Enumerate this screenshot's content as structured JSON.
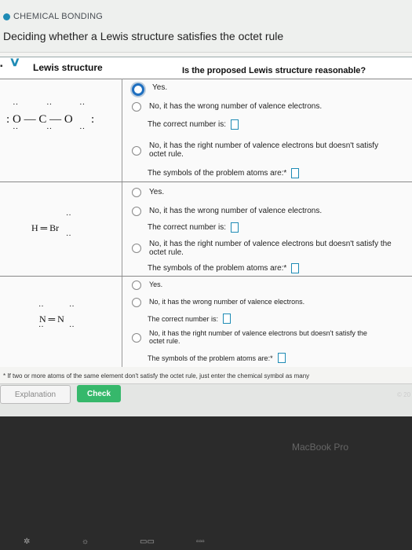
{
  "header": {
    "topic": "CHEMICAL BONDING",
    "title": "Deciding whether a Lewis structure satisfies the octet rule"
  },
  "table": {
    "col1": "Lewis structure",
    "col2": "Is the proposed Lewis structure reasonable?",
    "rows": [
      {
        "structure": "O — C — O",
        "opt_yes": "Yes.",
        "opt_wrong": "No, it has the wrong number of valence electrons.",
        "correct_number": "The correct number is:",
        "opt_octet_line1": "No, it has the right number of valence electrons but doesn't satisfy",
        "opt_octet_line2": "octet rule.",
        "symbols": "The symbols of the problem atoms are:*"
      },
      {
        "structure": "H ═ Br",
        "opt_yes": "Yes.",
        "opt_wrong": "No, it has the wrong number of valence electrons.",
        "correct_number": "The correct number is:",
        "opt_octet_line1": "No, it has the right number of valence electrons but doesn't satisfy the",
        "opt_octet_line2": "octet rule.",
        "symbols": "The symbols of the problem atoms are:*"
      },
      {
        "structure": "N ═ N",
        "opt_yes": "Yes.",
        "opt_wrong": "No, it has the wrong number of valence electrons.",
        "correct_number": "The correct number is:",
        "opt_octet_line1": "No, it has the right number of valence electrons but doesn't satisfy the",
        "opt_octet_line2": "octet rule.",
        "symbols": "The symbols of the problem atoms are:*"
      }
    ]
  },
  "footnote": "* If two or more atoms of the same element don't satisfy the octet rule, just enter the chemical symbol as many",
  "buttons": {
    "explanation": "Explanation",
    "check": "Check"
  },
  "copyright": "© 20",
  "laptop_brand": "MacBook Pro",
  "colors": {
    "accent": "#1e8bb5",
    "check_button": "#36b86b"
  }
}
